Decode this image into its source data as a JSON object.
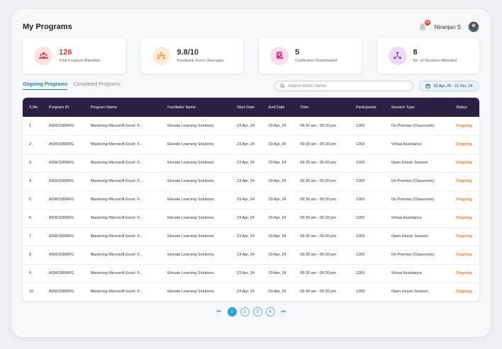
{
  "header": {
    "title": "My Programs",
    "notification_count": "99",
    "user_name": "Niranjan S"
  },
  "stats": [
    {
      "value": "126",
      "label": "Total Program Attended",
      "icon": "people-icon",
      "color": "#e53935",
      "bg": "#fde3e3"
    },
    {
      "value": "9.8/10",
      "label": "Feedback Score (Average)",
      "icon": "group-icon",
      "color": "#f59b3a",
      "bg": "#fdecd8"
    },
    {
      "value": "5",
      "label": "Certificates Downloaded",
      "icon": "certificate-icon",
      "color": "#d63384",
      "bg": "#fbdcea"
    },
    {
      "value": "8",
      "label": "No. of Sessions Attended",
      "icon": "network-icon",
      "color": "#8e44ad",
      "bg": "#eadcf5"
    }
  ],
  "tabs": [
    {
      "label": "Ongoing Programs",
      "active": true
    },
    {
      "label": "Completed Programs",
      "active": false
    }
  ],
  "search": {
    "placeholder": "Search Batch Name"
  },
  "date_range": "25 Apr, 25 - 21 Oct, 24",
  "table": {
    "columns": [
      "S.No",
      "Program ID",
      "Program Name",
      "Facilitator Name",
      "Start Date",
      "End Date",
      "Time",
      "Participants",
      "Session Type",
      "Status"
    ],
    "rows": [
      [
        "1",
        "ASW15896FG",
        "Mastering Microsoft Excel: F...",
        "Elevate Learning Solutions",
        "23 Apr, 24",
        "29 Apr, 24",
        "09:30 am - 05:30 pm",
        "1269",
        "On Premise (Classroom)",
        "Ongoing"
      ],
      [
        "2",
        "ASW15896FG",
        "Mastering Microsoft Excel: F...",
        "Elevate Learning Solutions",
        "23 Apr, 24",
        "29 Apr, 24",
        "09:30 am - 05:30 pm",
        "1269",
        "Virtual Assistance",
        "Ongoing"
      ],
      [
        "3",
        "ASW15896FG",
        "Mastering Microsoft Excel: F...",
        "Elevate Learning Solutions",
        "23 Apr, 24",
        "29 Apr, 24",
        "09:30 am - 05:30 pm",
        "1269",
        "Open House Session",
        "Ongoing"
      ],
      [
        "4",
        "ASW15896FG",
        "Mastering Microsoft Excel: F...",
        "Elevate Learning Solutions",
        "23 Apr, 24",
        "29 Apr, 24",
        "09:30 am - 05:30 pm",
        "1269",
        "On Premise (Classroom)",
        "Ongoing"
      ],
      [
        "5",
        "ASW15896FG",
        "Mastering Microsoft Excel: F...",
        "Elevate Learning Solutions",
        "23 Apr, 24",
        "29 Apr, 24",
        "09:30 am - 05:30 pm",
        "1269",
        "On Premise (Classroom)",
        "Ongoing"
      ],
      [
        "6",
        "ASW15896FG",
        "Mastering Microsoft Excel: F...",
        "Elevate Learning Solutions",
        "23 Apr, 24",
        "29 Apr, 24",
        "09:30 am - 05:30 pm",
        "1269",
        "Virtual Assistance",
        "Ongoing"
      ],
      [
        "7",
        "ASW15896FG",
        "Mastering Microsoft Excel: F...",
        "Elevate Learning Solutions",
        "23 Apr, 24",
        "29 Apr, 24",
        "09:30 am - 05:30 pm",
        "1269",
        "Open House Session",
        "Ongoing"
      ],
      [
        "8",
        "ASW15896FG",
        "Mastering Microsoft Excel: F...",
        "Elevate Learning Solutions",
        "23 Apr, 24",
        "29 Apr, 24",
        "09:30 am - 05:30 pm",
        "1269",
        "On Premise (Classroom)",
        "Ongoing"
      ],
      [
        "9",
        "ASW15896FG",
        "Mastering Microsoft Excel: F...",
        "Elevate Learning Solutions",
        "23 Apr, 24",
        "29 Apr, 24",
        "09:30 am - 05:30 pm",
        "1269",
        "Virtual Assistance",
        "Ongoing"
      ],
      [
        "10",
        "ASW15896FG",
        "Mastering Microsoft Excel: F...",
        "Elevate Learning Solutions",
        "23 Apr, 24",
        "29 Apr, 24",
        "09:30 am - 05:30 pm",
        "1269",
        "Open House Session",
        "Ongoing"
      ]
    ]
  },
  "pagination": {
    "pages": [
      "1",
      "2",
      "3",
      "4"
    ],
    "current": "1",
    "first_icon": "first-page-icon",
    "last_icon": "last-page-icon"
  }
}
